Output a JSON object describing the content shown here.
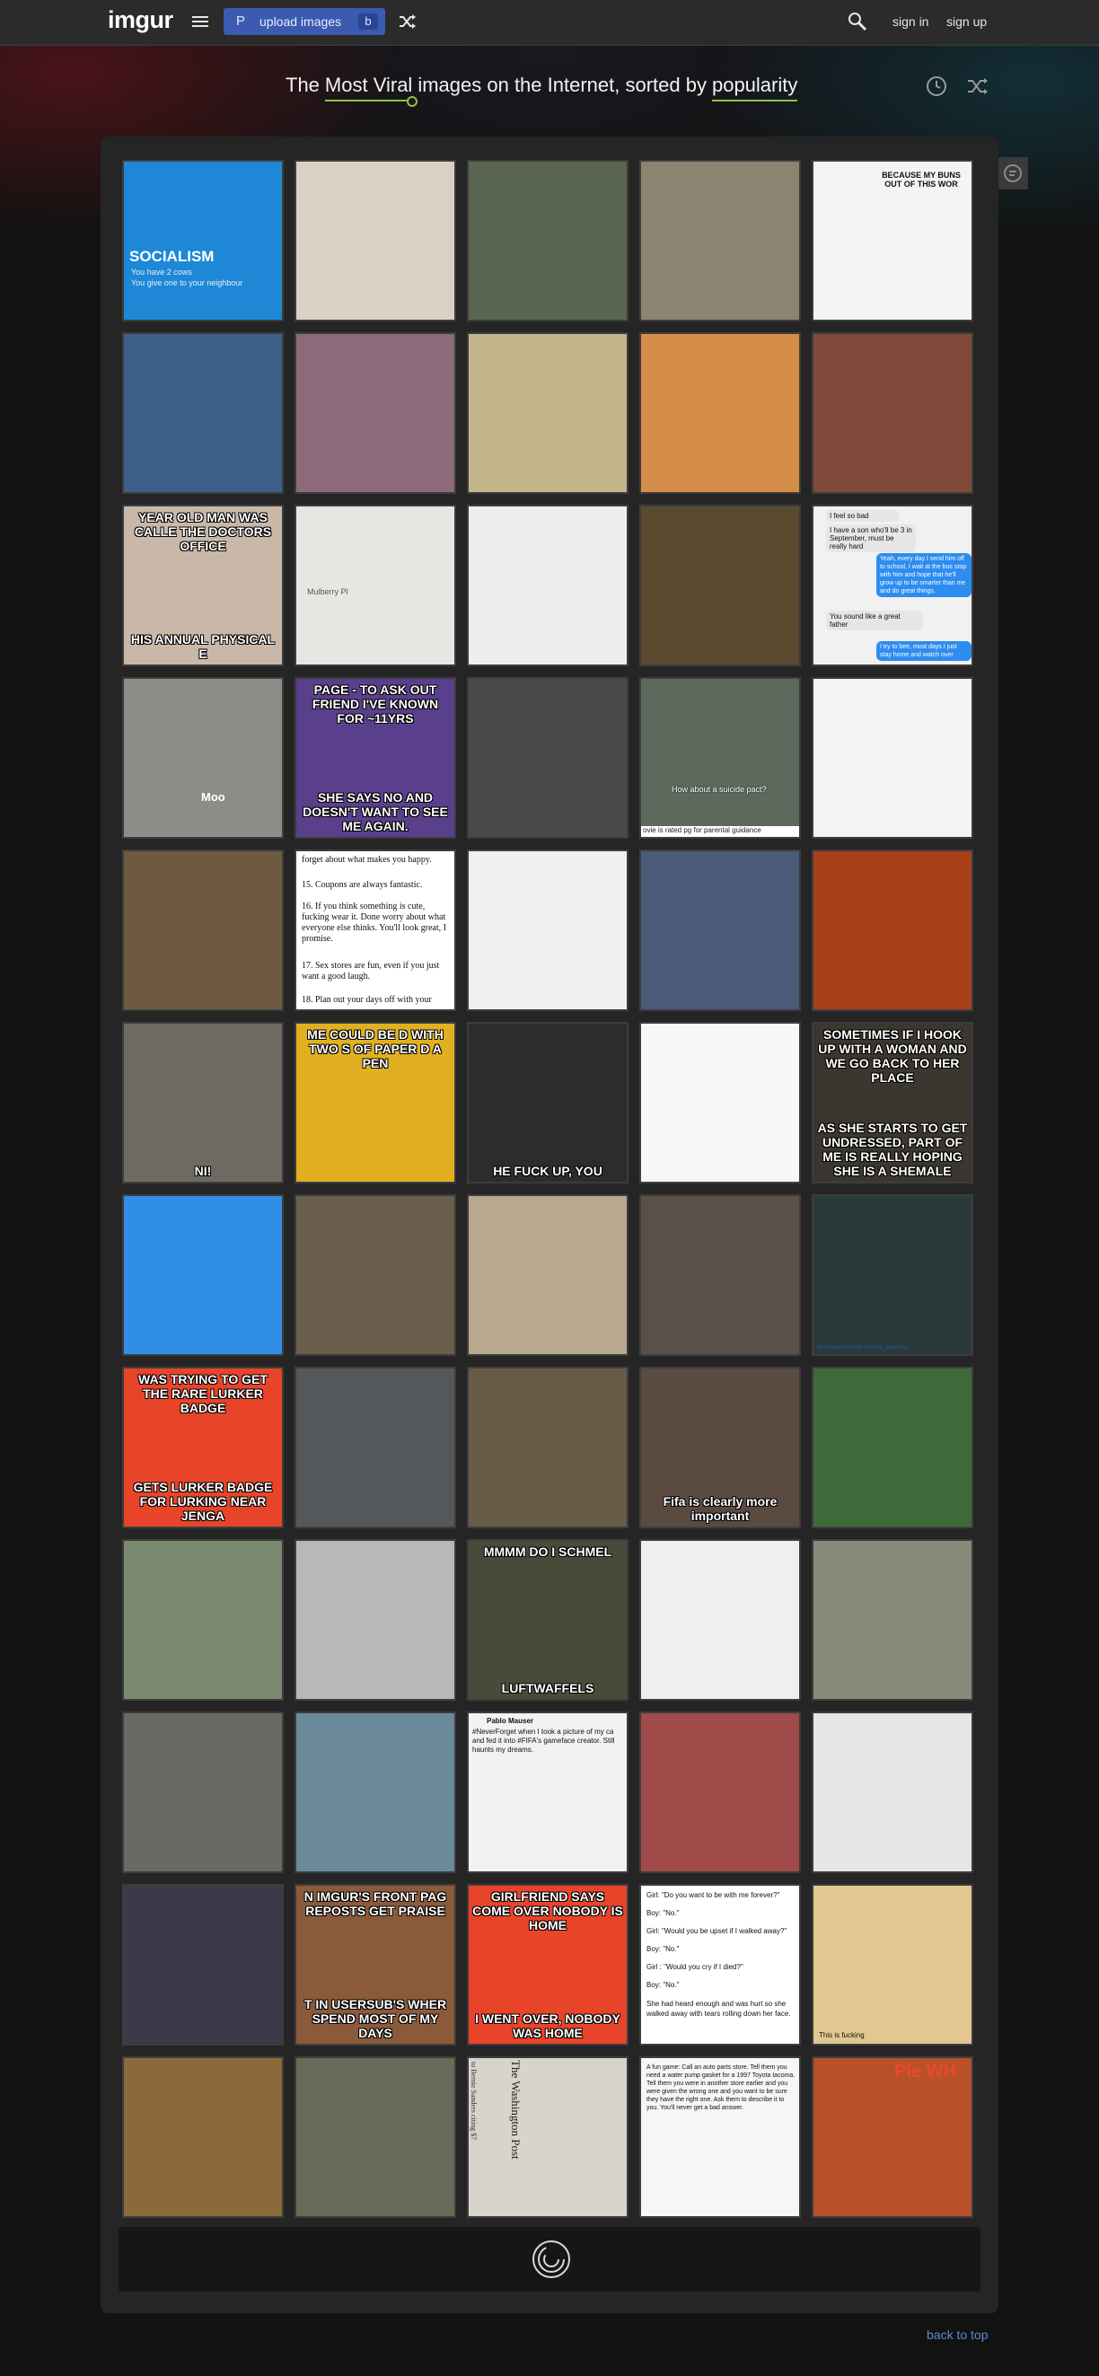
{
  "header": {
    "logo": "imgur",
    "upload_label": "upload images",
    "upload_prefix": "P",
    "upload_suffix": "b",
    "signin": "sign in",
    "signup": "sign up"
  },
  "heading": {
    "prefix": "The",
    "sort_by": "Most Viral",
    "middle": "images on the Internet, sorted by",
    "order": "popularity"
  },
  "gallery": {
    "tiles": [
      {
        "top": "",
        "bottom": "",
        "bg": "#1e88d6"
      },
      {
        "top": "",
        "bottom": "",
        "bg": "#d9d2c4"
      },
      {
        "top": "",
        "bottom": "",
        "bg": "#5a6650"
      },
      {
        "top": "",
        "bottom": "",
        "bg": "#8a8470"
      },
      {
        "top": "",
        "bottom": "",
        "bg": "#f4f4f4"
      },
      {
        "top": "",
        "bottom": "",
        "bg": "#3e5f8a"
      },
      {
        "top": "",
        "bottom": "",
        "bg": "#8c6a7a"
      },
      {
        "top": "",
        "bottom": "",
        "bg": "#c2b58a"
      },
      {
        "top": "",
        "bottom": "",
        "bg": "#d48e4a"
      },
      {
        "top": "",
        "bottom": "",
        "bg": "#7f4a3a"
      },
      {
        "top": "YEAR OLD MAN WAS CALLE THE DOCTORS OFFICE",
        "bottom": "HIS ANNUAL PHYSICAL E",
        "bg": "#c9b8a8"
      },
      {
        "top": "",
        "bottom": "",
        "bg": "#e6e6e2"
      },
      {
        "top": "",
        "bottom": "",
        "bg": "#eeeeee"
      },
      {
        "top": "",
        "bottom": "",
        "bg": "#5a4a30"
      },
      {
        "top": "",
        "bottom": "",
        "bg": "#f1f1f1"
      },
      {
        "top": "",
        "bottom": "",
        "bg": "#8d8d88"
      },
      {
        "top": "PAGE - TO ASK OUT FRIEND I'VE KNOWN FOR ~11YRS",
        "bottom": "SHE SAYS NO AND DOESN'T WANT TO SEE ME AGAIN.",
        "bg": "#5a3f8c"
      },
      {
        "top": "",
        "bottom": "",
        "bg": "#4a4a4a"
      },
      {
        "top": "",
        "bottom": "",
        "bg": "#5c6a5e"
      },
      {
        "top": "",
        "bottom": "",
        "bg": "#f3f3f3"
      },
      {
        "top": "",
        "bottom": "",
        "bg": "#6d5a40"
      },
      {
        "top": "",
        "bottom": "",
        "bg": "#ffffff"
      },
      {
        "top": "",
        "bottom": "",
        "bg": "#f0f0f0"
      },
      {
        "top": "",
        "bottom": "",
        "bg": "#4a5a78"
      },
      {
        "top": "",
        "bottom": "",
        "bg": "#a8401a"
      },
      {
        "top": "",
        "bottom": "NI!",
        "bg": "#6e6a62"
      },
      {
        "top": "ME COULD BE D WITH TWO S OF PAPER D A PEN",
        "bottom": "",
        "bg": "#e0b020"
      },
      {
        "top": "",
        "bottom": "HE FUCK UP, YOU",
        "bg": "#2c2c2c"
      },
      {
        "top": "",
        "bottom": "",
        "bg": "#f7f7f7"
      },
      {
        "top": "SOMETIMES IF I HOOK UP WITH A WOMAN AND WE GO BACK TO HER PLACE",
        "bottom": "AS SHE STARTS TO GET UNDRESSED, PART OF ME IS REALLY HOPING SHE IS A SHEMALE",
        "bg": "#3b3630"
      },
      {
        "top": "",
        "bottom": "",
        "bg": "#2f8fe6"
      },
      {
        "top": "",
        "bottom": "",
        "bg": "#6a5e4c"
      },
      {
        "top": "",
        "bottom": "",
        "bg": "#b8a890"
      },
      {
        "top": "",
        "bottom": "",
        "bg": "#5a5048"
      },
      {
        "top": "",
        "bottom": "",
        "bg": "#2a3a3a"
      },
      {
        "top": "WAS TRYING TO GET THE RARE LURKER BADGE",
        "bottom": "GETS LURKER BADGE FOR LURKING NEAR JENGA",
        "bg": "#e8442a"
      },
      {
        "top": "",
        "bottom": "",
        "bg": "#55585a"
      },
      {
        "top": "",
        "bottom": "",
        "bg": "#6a5a48"
      },
      {
        "top": "",
        "bottom": "Fifa is clearly more important",
        "bg": "#5a4a40"
      },
      {
        "top": "",
        "bottom": "",
        "bg": "#3e6a3a"
      },
      {
        "top": "",
        "bottom": "",
        "bg": "#7a8a70"
      },
      {
        "top": "",
        "bottom": "",
        "bg": "#b8b8b8"
      },
      {
        "top": "MMMM DO I SCHMEL",
        "bottom": "LUFTWAFFELS",
        "bg": "#4a4a3a"
      },
      {
        "top": "",
        "bottom": "",
        "bg": "#efefef"
      },
      {
        "top": "",
        "bottom": "",
        "bg": "#8a8a7a"
      },
      {
        "top": "",
        "bottom": "",
        "bg": "#6a6a64"
      },
      {
        "top": "",
        "bottom": "",
        "bg": "#6a8a9a"
      },
      {
        "top": "",
        "bottom": "",
        "bg": "#f2f2f2"
      },
      {
        "top": "",
        "bottom": "",
        "bg": "#a04a4a"
      },
      {
        "top": "",
        "bottom": "",
        "bg": "#e6e6e6"
      },
      {
        "top": "",
        "bottom": "",
        "bg": "#3a3a48"
      },
      {
        "top": "N IMGUR'S FRONT PAG REPOSTS GET PRAISE",
        "bottom": "T IN USERSUB'S WHER SPEND MOST OF MY DAYS",
        "bg": "#8a5a3a"
      },
      {
        "top": "GIRLFRIEND SAYS COME OVER NOBODY IS HOME",
        "bottom": "I WENT OVER, NOBODY WAS HOME",
        "bg": "#e8442a"
      },
      {
        "top": "",
        "bottom": "",
        "bg": "#ffffff"
      },
      {
        "top": "",
        "bottom": "",
        "bg": "#e2c890"
      },
      {
        "top": "",
        "bottom": "",
        "bg": "#8a6a3a"
      },
      {
        "top": "",
        "bottom": "",
        "bg": "#6a6a58"
      },
      {
        "top": "",
        "bottom": "",
        "bg": "#d8d4cc"
      },
      {
        "top": "",
        "bottom": "",
        "bg": "#f6f6f4"
      },
      {
        "top": "",
        "bottom": "",
        "bg": "#b8502a"
      }
    ],
    "texts": {
      "socialism_title": "SOCIALISM",
      "socialism_line1": "You have 2 cows",
      "socialism_line2": "You give one to your neighbour",
      "buns": "BECAUSE MY BUNS OUT OF THIS WOR",
      "moo": "Moo",
      "chat_1": "I feel so bad",
      "chat_2": "I have a son who'll be 3 in September, must be really hard",
      "chat_3": "Yeah, every day I send him off to school, I wait at the bus stop with him and hope that he'll grow up to be smarter than me and do great things.",
      "chat_4": "You sound like a great father",
      "chat_5": "I try to bee, most days I just stay home and watch over",
      "map_label": "Mulberry Pl",
      "bee_caption": "How about a suicide pact?",
      "bee_rating": "ovie is rated pg for parental guidance",
      "advice_1": "forget about what makes you happy.",
      "advice_2": "15. Coupons are always fantastic.",
      "advice_3": "16. If you think something is cute, fucking wear it. Done worry about what everyone else thinks. You'll look great, I promise.",
      "advice_4": "17. Sex stores are fun, even if you just want a good laugh.",
      "advice_5": "18. Plan out your days off with your",
      "dialogue_1": "Girl: \"Do you want to be with me forever?\"",
      "dialogue_2": "Boy: \"No.\"",
      "dialogue_3": "Girl: \"Would you be upset if I walked away?\"",
      "dialogue_4": "Boy: \"No.\"",
      "dialogue_5": "Girl : \"Would you cry if I died?\"",
      "dialogue_6": "Boy: \"No.\"",
      "dialogue_7": "She had heard enough and was hurt so she walked away with tears rolling down her face.",
      "gasket": "A fun game: Call an auto parts store. Tell them you need a water pump gasket for a 1997 Toyota tacoma. Tell them you were in another store earlier and you were given the wrong one and you want to be sure they have the right one. Ask them to describe it to you. You'll never get a bad answer.",
      "tweet_name": "Pablo Mauser",
      "tweet_text": "#NeverForget when I took a picture of my ca and fed it into #FIFA's gameface creator. Still haunts my dreams.",
      "insta_user": "andrewsevenyfivet, samuel_jaelurdon.",
      "plex": "Ple WH",
      "wapo": "The Washington Post",
      "newspaper": "to Bernie Sanders citing $7",
      "book": "This is fucking"
    }
  },
  "footer": {
    "back_to_top": "back to top"
  }
}
